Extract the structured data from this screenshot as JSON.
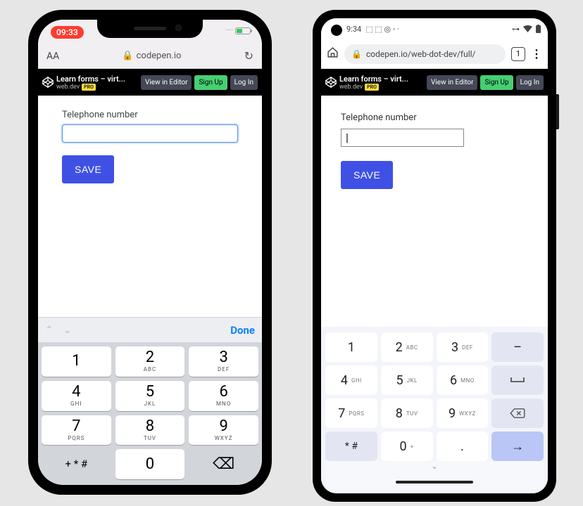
{
  "ios": {
    "status": {
      "time": "09:33",
      "signal_dots": "····",
      "charging_glyph": "⚡"
    },
    "safari": {
      "aa": "AA",
      "lock_glyph": "🔒",
      "url": "codepen.io",
      "refresh_glyph": "↻"
    },
    "codepen": {
      "title": "Learn forms – virt...",
      "author": "web.dev",
      "pro": "PRO",
      "view_btn": "View in Editor",
      "signup_btn": "Sign Up",
      "login_btn": "Log In"
    },
    "form": {
      "label": "Telephone number",
      "value": "",
      "save": "SAVE"
    },
    "accessory": {
      "up": "⌃",
      "down": "⌄",
      "done": "Done"
    },
    "keypad": {
      "keys": [
        {
          "d": "1",
          "l": ""
        },
        {
          "d": "2",
          "l": "ABC"
        },
        {
          "d": "3",
          "l": "DEF"
        },
        {
          "d": "4",
          "l": "GHI"
        },
        {
          "d": "5",
          "l": "JKL"
        },
        {
          "d": "6",
          "l": "MNO"
        },
        {
          "d": "7",
          "l": "PQRS"
        },
        {
          "d": "8",
          "l": "TUV"
        },
        {
          "d": "9",
          "l": "WXYZ"
        }
      ],
      "symbols": "+ * #",
      "zero": "0",
      "backspace": "⌫"
    }
  },
  "android": {
    "status": {
      "time": "9:34",
      "left_glyphs": "⬚ ⬚ ◎ ◦ ·",
      "vpn": "⊶",
      "wifi": "▲",
      "battery": "▮"
    },
    "chrome": {
      "home_glyph": "⌂",
      "lock_glyph": "🔒",
      "url": "codepen.io/web-dot-dev/full/",
      "tab_count": "1",
      "menu_glyph": "⋮"
    },
    "codepen": {
      "title": "Learn forms – virt...",
      "author": "web.dev",
      "pro": "PRO",
      "view_btn": "View in Editor",
      "signup_btn": "Sign Up",
      "login_btn": "Log In"
    },
    "form": {
      "label": "Telephone number",
      "value": "",
      "cursor": "|",
      "save": "SAVE"
    },
    "keypad": {
      "rows": [
        [
          {
            "d": "1",
            "l": ""
          },
          {
            "d": "2",
            "l": "ABC"
          },
          {
            "d": "3",
            "l": "DEF"
          },
          {
            "d": "–",
            "l": "",
            "muted": true
          }
        ],
        [
          {
            "d": "4",
            "l": "GHI"
          },
          {
            "d": "5",
            "l": "JKL"
          },
          {
            "d": "6",
            "l": "MNO"
          },
          {
            "d": "␣",
            "l": "",
            "muted": true,
            "glyph": "space"
          }
        ],
        [
          {
            "d": "7",
            "l": "PQRS"
          },
          {
            "d": "8",
            "l": "TUV"
          },
          {
            "d": "9",
            "l": "WXYZ"
          },
          {
            "d": "⌫",
            "l": "",
            "muted": true
          }
        ],
        [
          {
            "d": "* #",
            "l": "",
            "muted": true
          },
          {
            "d": "0",
            "l": "+"
          },
          {
            "d": ".",
            "l": ""
          },
          {
            "d": "→",
            "l": "",
            "accent": true
          }
        ]
      ],
      "chevron": "⌄"
    }
  }
}
